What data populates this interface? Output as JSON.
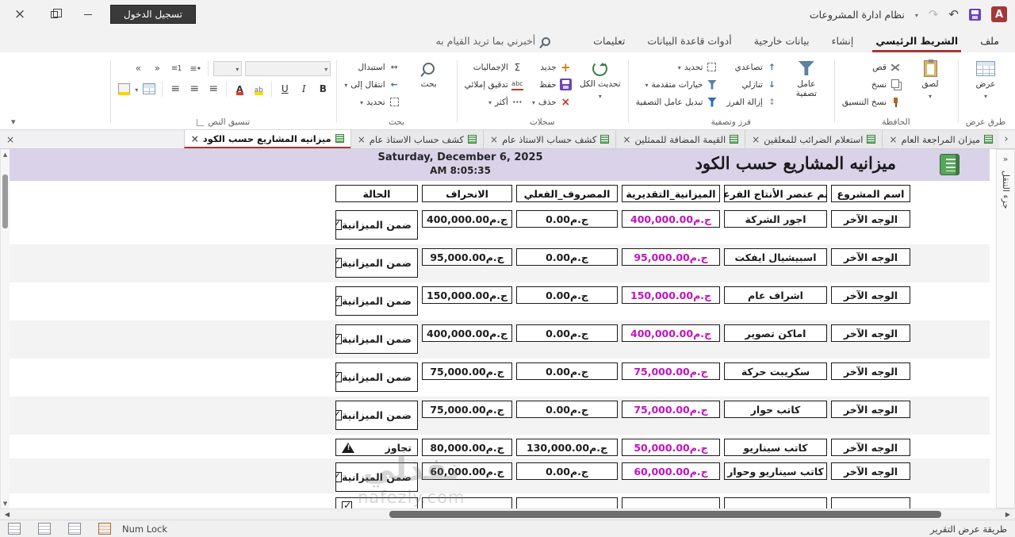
{
  "titlebar": {
    "title": "نظام ادارة المشروعات",
    "login_label": "تسجيل الدخول"
  },
  "ribbon": {
    "file_tab": "ملف",
    "tabs": [
      {
        "label": "الشريط الرئيسي",
        "active": true
      },
      {
        "label": "إنشاء"
      },
      {
        "label": "بيانات خارجية"
      },
      {
        "label": "أدوات قاعدة البيانات"
      },
      {
        "label": "تعليمات"
      }
    ],
    "tell_me": "أخبرني بما تريد القيام به",
    "groups": {
      "views": {
        "label": "طرق عرض",
        "view": "عرض"
      },
      "clipboard": {
        "label": "الحافظة",
        "paste": "لصق",
        "cut": "قص",
        "copy": "نسخ",
        "format_painter": "نسخ التنسيق"
      },
      "sort_filter": {
        "label": "فرز وتصفية",
        "filter": "عامل تصفية",
        "ascending": "تصاعدي",
        "descending": "تنازلي",
        "remove_sort": "إزالة الفرز",
        "selection": "تحديد",
        "advanced": "خيارات متقدمة",
        "toggle_filter": "تبديل عامل التصفية"
      },
      "records": {
        "label": "سجلات",
        "refresh_all": "تحديث الكل",
        "new": "جديد",
        "save": "حفظ",
        "delete": "حذف",
        "totals": "الإجماليات",
        "spelling": "تدقيق إملائي",
        "more": "أكثر"
      },
      "find": {
        "label": "بحث",
        "find": "بحث",
        "replace": "استبدال",
        "goto": "انتقال إلى",
        "select": "تحديد"
      },
      "text_format": {
        "label": "تنسيق النص"
      }
    }
  },
  "doc_tabs": [
    {
      "label": "ميزان المراجعة العام"
    },
    {
      "label": "استعلام الضرائب للمعلقين"
    },
    {
      "label": "القيمة المضافة للممثلين"
    },
    {
      "label": "كشف حساب الاستاذ عام"
    },
    {
      "label": "كشف حساب الاستاذ عام"
    },
    {
      "label": "ميزانيه المشاريع حسب الكود",
      "active": true
    }
  ],
  "report": {
    "title": "ميزانيه المشاريع حسب الكود",
    "date": "Saturday, December 6, 2025",
    "time": "8:05:35 AM",
    "columns": {
      "project": "اسم المشروع",
      "element": "اسم عنصر الأنتاج الفرعى",
      "budget": "الميزانية_التقديرية",
      "actual": "المصروف_الفعلي",
      "deviation": "الانحراف",
      "status": "الحالة"
    },
    "rows": [
      {
        "project": "الوجه الآخر",
        "element": "اجور الشركة",
        "budget": "ج.م400,000.00",
        "actual": "ج.م0.00",
        "deviation": "ج.م400,000.00",
        "status": "ضمن الميزانية",
        "status_type": "ok"
      },
      {
        "project": "الوجه الآخر",
        "element": "اسبيشيال ايفكت",
        "budget": "ج.م95,000.00",
        "actual": "ج.م0.00",
        "deviation": "ج.م95,000.00",
        "status": "ضمن الميزانية",
        "status_type": "ok"
      },
      {
        "project": "الوجه الآخر",
        "element": "اشراف عام",
        "budget": "ج.م150,000.00",
        "actual": "ج.م0.00",
        "deviation": "ج.م150,000.00",
        "status": "ضمن الميزانية",
        "status_type": "ok"
      },
      {
        "project": "الوجه الآخر",
        "element": "اماكن تصوير",
        "budget": "ج.م400,000.00",
        "actual": "ج.م0.00",
        "deviation": "ج.م400,000.00",
        "status": "ضمن الميزانية",
        "status_type": "ok"
      },
      {
        "project": "الوجه الآخر",
        "element": "سكريبت حركة",
        "budget": "ج.م75,000.00",
        "actual": "ج.م0.00",
        "deviation": "ج.م75,000.00",
        "status": "ضمن الميزانية",
        "status_type": "ok"
      },
      {
        "project": "الوجه الآخر",
        "element": "كاتب حوار",
        "budget": "ج.م75,000.00",
        "actual": "ج.م0.00",
        "deviation": "ج.م75,000.00",
        "status": "ضمن الميزانية",
        "status_type": "ok"
      },
      {
        "project": "الوجه الآخر",
        "element": "كاتب سيناريو",
        "budget": "ج.م50,000.00",
        "actual": "ج.م130,000.00",
        "deviation": "ج.م80,000.00",
        "status": "تجاوز",
        "status_type": "warn"
      },
      {
        "project": "الوجه الآخر",
        "element": "كاتب سيناريو وحوار",
        "budget": "ج.م60,000.00",
        "actual": "ج.م0.00",
        "deviation": "ج.م60,000.00",
        "status": "ضمن الميزانية",
        "status_type": "ok"
      }
    ]
  },
  "statusbar": {
    "num_lock": "Num Lock",
    "view_mode": "طريقة عرض التقرير"
  },
  "nav_pane": {
    "label": "جزء التنقل"
  },
  "watermark": {
    "line1": "نفذلي",
    "line2": "nafezly.com"
  },
  "icons": {
    "access-app-icon": "A",
    "save-icon": "purple-floppy",
    "undo-icon": "↶",
    "redo-icon": "↷",
    "search-icon": "magnifier",
    "close-icon": "×",
    "minimize-icon": "—",
    "restore-icon": "double-square",
    "checkbox-checked-icon": "☑",
    "warning-icon": "⚠",
    "filter-icon": "funnel",
    "refresh-icon": "circular-arrows",
    "table-icon": "green-grid",
    "report-icon": "green-notebook"
  }
}
